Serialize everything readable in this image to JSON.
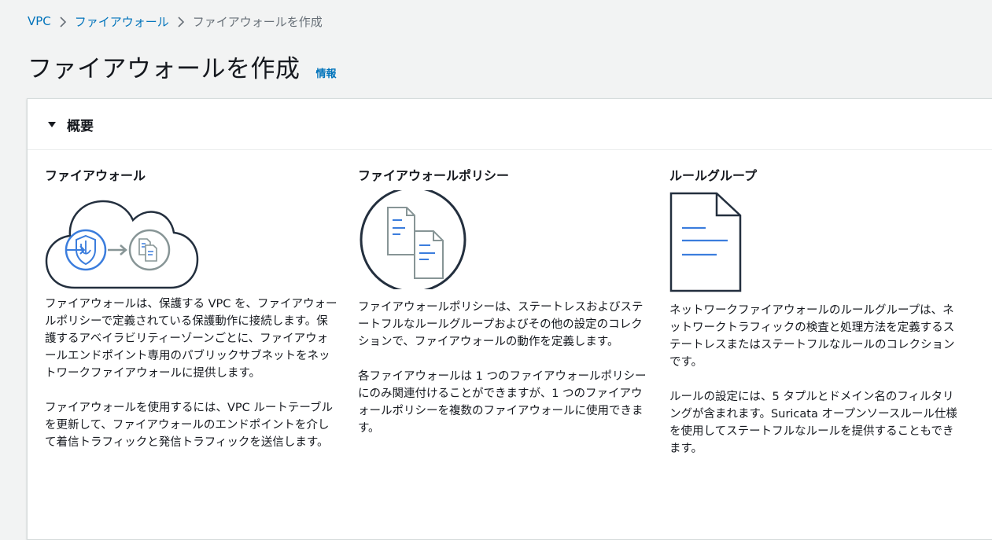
{
  "breadcrumb": {
    "items": [
      "VPC",
      "ファイアウォール"
    ],
    "current": "ファイアウォールを作成"
  },
  "page": {
    "title": "ファイアウォールを作成",
    "info_link": "情報"
  },
  "overview": {
    "header": "概要",
    "columns": [
      {
        "title": "ファイアウォール",
        "icon": "cloud-firewall-icon",
        "paragraphs": [
          "ファイアウォールは、保護する VPC を、ファイアウォールポリシーで定義されている保護動作に接続します。保護するアベイラビリティーゾーンごとに、ファイアウォールエンドポイント専用のパブリックサブネットをネットワークファイアウォールに提供します。",
          "ファイアウォールを使用するには、VPC ルートテーブルを更新して、ファイアウォールのエンドポイントを介して着信トラフィックと発信トラフィックを送信します。"
        ]
      },
      {
        "title": "ファイアウォールポリシー",
        "icon": "policy-documents-icon",
        "paragraphs": [
          "ファイアウォールポリシーは、ステートレスおよびステートフルなルールグループおよびその他の設定のコレクションで、ファイアウォールの動作を定義します。",
          "各ファイアウォールは 1 つのファイアウォールポリシーにのみ関連付けることができますが、1 つのファイアウォールポリシーを複数のファイアウォールに使用できます。"
        ]
      },
      {
        "title": "ルールグループ",
        "icon": "document-icon",
        "paragraphs": [
          "ネットワークファイアウォールのルールグループは、ネットワークトラフィックの検査と処理方法を定義するステートレスまたはステートフルなルールのコレクションです。",
          "ルールの設定には、5 タプルとドメイン名のフィルタリングが含まれます。Suricata オープンソースルール仕様を使用してステートフルなルールを提供することもできます。"
        ]
      }
    ]
  },
  "colors": {
    "link": "#0073bb",
    "accent_blue": "#3b7ddd",
    "icon_gray": "#879596",
    "icon_dark": "#232f3e"
  }
}
